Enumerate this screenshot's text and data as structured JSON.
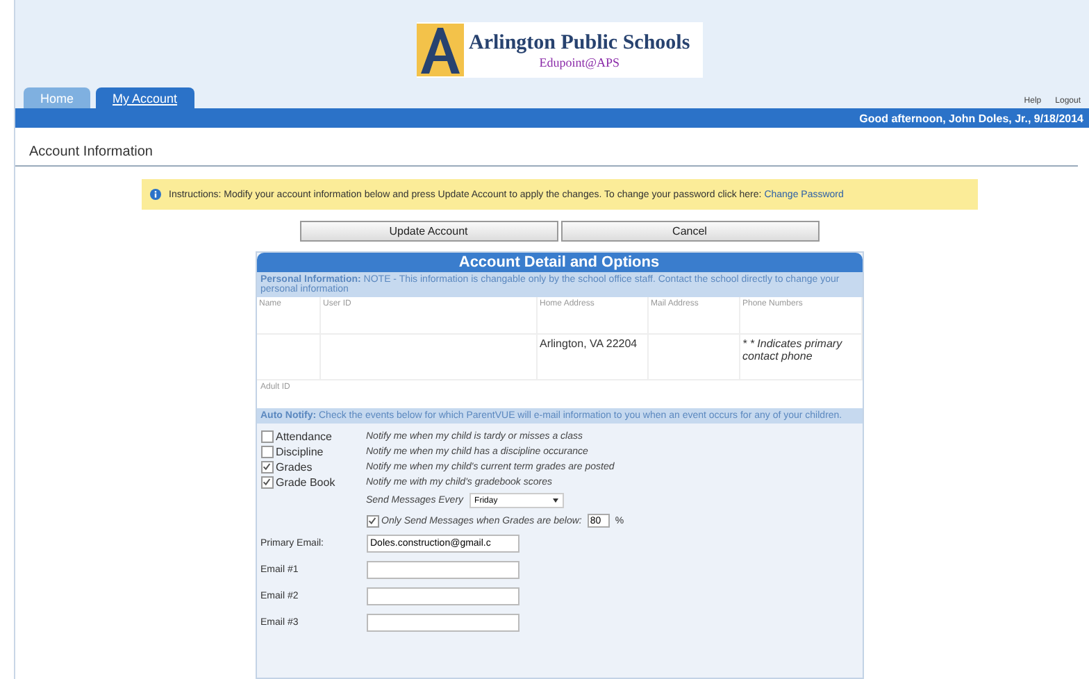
{
  "logo": {
    "title": "Arlington Public Schools",
    "subtitle": "Edupoint@APS"
  },
  "tabs": [
    {
      "label": "Home",
      "selected": false
    },
    {
      "label": "My Account",
      "selected": true
    }
  ],
  "top_links": [
    "Help",
    "Logout"
  ],
  "greeting": "Good afternoon, John Doles, Jr., 9/18/2014",
  "page_title": "Account Information",
  "notice": {
    "text": "Instructions: Modify your account information below and press Update Account to apply the changes. To change your password click here:",
    "link": "Change Password"
  },
  "buttons": [
    "Update Account",
    "Cancel"
  ],
  "panel": {
    "title": "Account Detail and Options",
    "personal": {
      "label": "Personal Information:",
      "text": "NOTE - This information is changable only by the school office staff. Contact the school directly to change your personal information"
    },
    "columns": [
      "Name",
      "User ID",
      "Home Address",
      "Mail Address",
      "Phone Numbers"
    ],
    "row": {
      "home_address": "Arlington, VA 22204",
      "phone_numbers": "* * Indicates primary contact phone"
    },
    "adult_id_label": "Adult ID",
    "auto_notify": {
      "label": "Auto Notify:",
      "text": "Check the events below for which ParentVUE will e-mail information to you when an event occurs for any of your children."
    },
    "notifications": [
      {
        "label": "Attendance",
        "checked": false,
        "description": "Notify me when my child is tardy or misses a class"
      },
      {
        "label": "Discipline",
        "checked": false,
        "description": "Notify me when my child has a discipline occurance"
      },
      {
        "label": "Grades",
        "checked": true,
        "description": "Notify me when my child's current term grades are posted"
      },
      {
        "label": "Grade Book",
        "checked": true,
        "description": "Notify me with my child's gradebook scores"
      }
    ],
    "send_every": {
      "label": "Send Messages Every",
      "value": "Friday"
    },
    "threshold": {
      "checked": true,
      "label": "Only Send Messages when Grades are below:",
      "value": "80",
      "unit": "%"
    },
    "emails": [
      {
        "label": "Primary Email:",
        "value": "Doles.construction@gmail.c"
      },
      {
        "label": "Email #1"
      },
      {
        "label": "Email #2"
      },
      {
        "label": "Email #3"
      }
    ]
  }
}
